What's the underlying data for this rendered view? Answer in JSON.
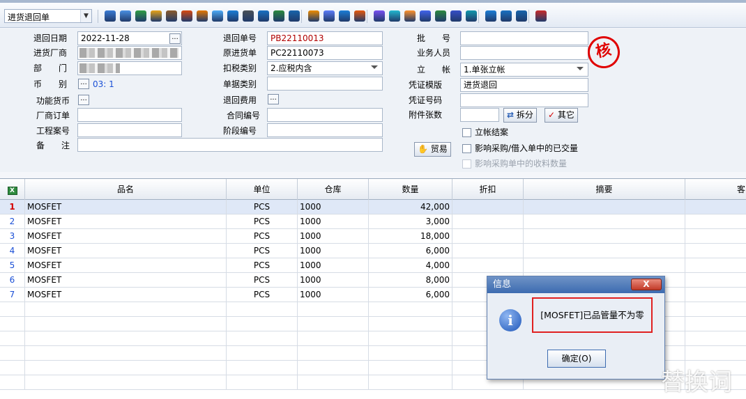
{
  "toolbar": {
    "doc_type": "进货退回单",
    "icons": [
      "search-icon",
      "monitor-icon",
      "refresh-icon",
      "home-icon",
      "briefcase-icon",
      "flag-icon",
      "people-icon",
      "image-icon",
      "book-icon",
      "key-icon",
      "help-icon",
      "dollar-icon",
      "truck-icon",
      "coins-icon",
      "export-icon",
      "notebook-icon",
      "printer-icon",
      "copy-icon",
      "target-icon",
      "tag-icon",
      "chart-icon",
      "users-icon",
      "screen-icon",
      "recycle-icon",
      "window-icon",
      "close-window-icon",
      "layers-icon",
      "exit-icon"
    ]
  },
  "form": {
    "return_date_label": "退回日期",
    "return_date": "2022-11-28",
    "supplier_label": "进货厂商",
    "department_label": "部　　门",
    "currency_label": "币　　别",
    "currency_value": "03: 1",
    "func_currency_label": "功能货币",
    "vendor_order_label": "厂商订单",
    "project_no_label": "工程案号",
    "remark_label": "备　　注",
    "return_no_label": "退回单号",
    "return_no": "PB22110013",
    "orig_purchase_label": "原进货单",
    "orig_purchase": "PC22110073",
    "tax_type_label": "扣税类别",
    "tax_type": "2.应税内含",
    "doc_category_label": "单据类别",
    "return_fee_label": "退回费用",
    "contract_no_label": "合同编号",
    "phase_no_label": "阶段编号",
    "batch_label": "批　　号",
    "salesperson_label": "业务人员",
    "account_label": "立　　帐",
    "account_value": "1.单张立帐",
    "voucher_template_label": "凭证模版",
    "voucher_template": "进货退回",
    "voucher_no_label": "凭证号码",
    "attachments_label": "附件张数",
    "split_label": "拆分",
    "other_label": "其它",
    "trade_label": "贸易",
    "close_account_label": "立帐结案",
    "affect_purchase_label": "影响采购/借入单中的已交量",
    "affect_receive_label": "影响采购单中的收料数量",
    "stamp_text": "核"
  },
  "grid": {
    "columns": [
      "品名",
      "单位",
      "仓库",
      "数量",
      "折扣",
      "摘要",
      "客"
    ],
    "rows": [
      {
        "no": "1",
        "name": "MOSFET",
        "unit": "PCS",
        "warehouse": "1000",
        "qty": "42,000"
      },
      {
        "no": "2",
        "name": "MOSFET",
        "unit": "PCS",
        "warehouse": "1000",
        "qty": "3,000"
      },
      {
        "no": "3",
        "name": "MOSFET",
        "unit": "PCS",
        "warehouse": "1000",
        "qty": "18,000"
      },
      {
        "no": "4",
        "name": "MOSFET",
        "unit": "PCS",
        "warehouse": "1000",
        "qty": "6,000"
      },
      {
        "no": "5",
        "name": "MOSFET",
        "unit": "PCS",
        "warehouse": "1000",
        "qty": "4,000"
      },
      {
        "no": "6",
        "name": "MOSFET",
        "unit": "PCS",
        "warehouse": "1000",
        "qty": "8,000"
      },
      {
        "no": "7",
        "name": "MOSFET",
        "unit": "PCS",
        "warehouse": "1000",
        "qty": "6,000"
      }
    ]
  },
  "dialog": {
    "title": "信息",
    "close": "X",
    "message": "[MOSFET]已品管量不为零",
    "ok": "确定(O)"
  },
  "watermark": "替换词"
}
